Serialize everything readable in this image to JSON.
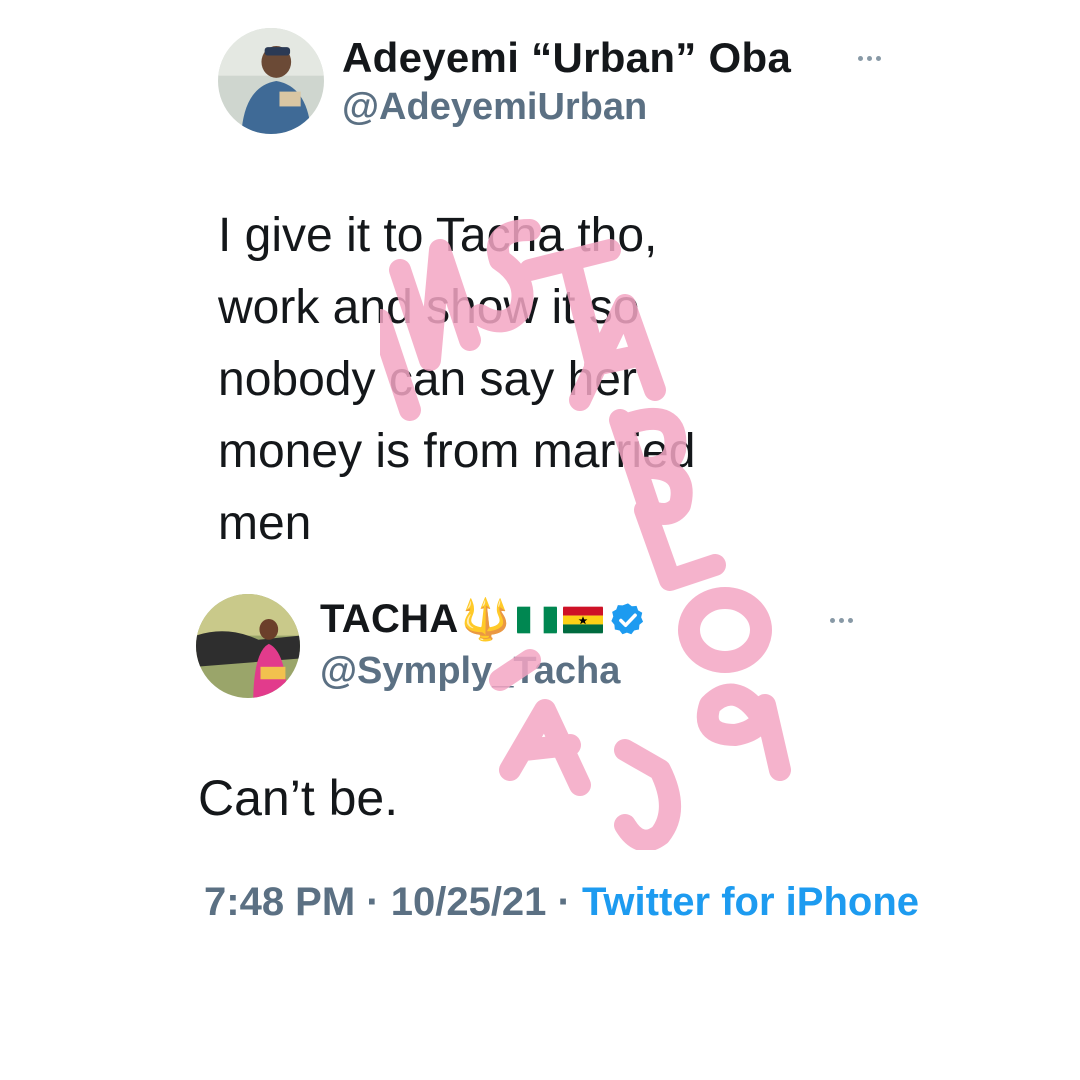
{
  "tweet": {
    "author": {
      "display_name": "Adeyemi “Urban” Oba",
      "handle": "@AdeyemiUrban"
    },
    "text": "I give it to Tacha tho,\nwork and show it so\nnobody can say her\nmoney is from married\nmen"
  },
  "reply": {
    "author": {
      "display_name": "TACHA",
      "name_emoji": "🔱",
      "flags": [
        "nigeria-flag",
        "ghana-flag"
      ],
      "verified": true,
      "handle": "@Symply_Tacha"
    },
    "text": "Can’t be.",
    "meta": {
      "time": "7:48 PM",
      "separator": " · ",
      "date": "10/25/21",
      "source": "Twitter for iPhone"
    }
  },
  "watermark": {
    "text": "INSTABLOG9JA",
    "color": "#f4a6c4"
  },
  "colors": {
    "text": "#14171a",
    "secondary": "#5b7083",
    "link": "#1d9bf0",
    "verified": "#1d9bf0"
  }
}
